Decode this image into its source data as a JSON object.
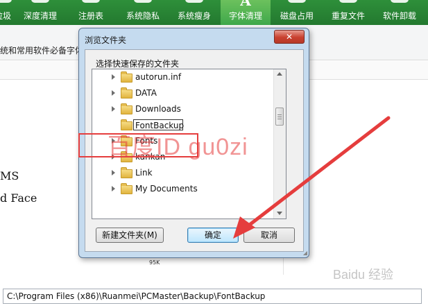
{
  "toolbar": {
    "tabs": [
      {
        "label": "垃圾",
        "active": false
      },
      {
        "label": "深度清理",
        "active": false
      },
      {
        "label": "注册表",
        "active": false
      },
      {
        "label": "系统隐私",
        "active": false
      },
      {
        "label": "系统瘦身",
        "active": false
      },
      {
        "label": "字体清理",
        "active": true,
        "icon": "A"
      },
      {
        "label": "磁盘占用",
        "active": false
      },
      {
        "label": "重复文件",
        "active": false
      },
      {
        "label": "软件卸载",
        "active": false
      }
    ]
  },
  "subbar": {
    "text": "统和常用软件必备字体"
  },
  "background": {
    "font_item_1": "MS",
    "font_item_2": "d Face",
    "size_value": "95K"
  },
  "path_field": {
    "value": "C:\\Program Files (x86)\\Ruanmei\\PCMaster\\Backup\\FontBackup"
  },
  "dialog": {
    "title": "浏览文件夹",
    "close_label": "✕",
    "prompt": "选择快速保存的文件夹",
    "tree_items": [
      {
        "label": "autorun.inf"
      },
      {
        "label": "DATA"
      },
      {
        "label": "Downloads"
      },
      {
        "label": "FontBackup",
        "editing": true
      },
      {
        "label": "Fonts"
      },
      {
        "label": "kankan"
      },
      {
        "label": "Link"
      },
      {
        "label": "My Documents"
      }
    ],
    "new_folder_button": "新建文件夹(M)",
    "ok_button": "确定",
    "cancel_button": "取消"
  },
  "annotations": {
    "watermark": "百度ID gu0zi",
    "watermark_bottom": "Baidu 经验",
    "highlight_color": "#e53d3d",
    "arrow_color": "#e53d3d"
  }
}
